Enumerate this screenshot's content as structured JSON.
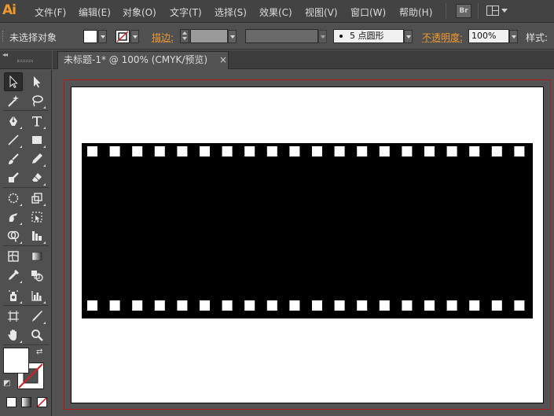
{
  "app": {
    "logo": "Ai",
    "menu": [
      "文件(F)",
      "编辑(E)",
      "对象(O)",
      "文字(T)",
      "选择(S)",
      "效果(C)",
      "视图(V)",
      "窗口(W)",
      "帮助(H)"
    ],
    "bridge_label": "Br"
  },
  "control_bar": {
    "selection_status": "未选择对象",
    "stroke_label": "描边:",
    "brush_value": "5 点圆形",
    "opacity_label": "不透明度:",
    "opacity_value": "100%",
    "style_label": "样式:",
    "fill_color": "#ffffff",
    "stroke_color": "none"
  },
  "toolbox": {
    "tools": [
      "selection-tool",
      "direct-selection-tool",
      "magic-wand-tool",
      "lasso-tool",
      "pen-tool",
      "type-tool",
      "line-segment-tool",
      "rectangle-tool",
      "paintbrush-tool",
      "pencil-tool",
      "blob-brush-tool",
      "eraser-tool",
      "rotate-tool",
      "scale-tool",
      "warp-tool",
      "free-transform-tool",
      "shape-builder-tool",
      "perspective-grid-tool",
      "mesh-tool",
      "gradient-tool",
      "eyedropper-tool",
      "blend-tool",
      "symbol-sprayer-tool",
      "column-graph-tool",
      "artboard-tool",
      "slice-tool",
      "hand-tool",
      "zoom-tool"
    ],
    "active_tool": "selection-tool",
    "fill": "#ffffff",
    "stroke": "none"
  },
  "document": {
    "tab_title": "未标题-1* @ 100% (CMYK/预览)",
    "close_glyph": "×",
    "artboard_color": "#ffffff",
    "artwork": {
      "name": "filmstrip",
      "fill": "#000000",
      "hole_color": "#ffffff",
      "holes_per_row": 20,
      "rows": 2
    }
  }
}
